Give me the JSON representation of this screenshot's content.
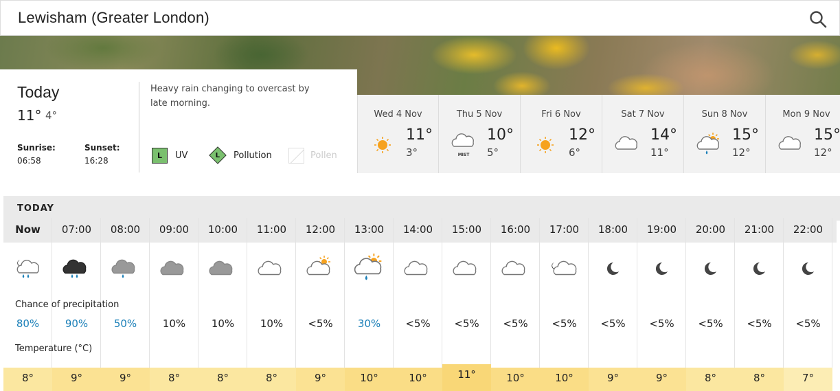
{
  "location": "Lewisham (Greater London)",
  "today": {
    "title": "Today",
    "high": "11°",
    "low": "4°",
    "sunrise_label": "Sunrise:",
    "sunrise": "06:58",
    "sunset_label": "Sunset:",
    "sunset": "16:28",
    "description": "Heavy rain changing to overcast by late morning.",
    "uv": {
      "level": "L",
      "label": "UV"
    },
    "pollution": {
      "level": "L",
      "label": "Pollution"
    },
    "pollen": {
      "label": "Pollen"
    }
  },
  "days": [
    {
      "name": "Wed 4 Nov",
      "icon": "sun",
      "high": "11°",
      "low": "3°"
    },
    {
      "name": "Thu 5 Nov",
      "icon": "mist",
      "high": "10°",
      "low": "5°"
    },
    {
      "name": "Fri 6 Nov",
      "icon": "sun",
      "high": "12°",
      "low": "6°"
    },
    {
      "name": "Sat 7 Nov",
      "icon": "cloud",
      "high": "14°",
      "low": "11°"
    },
    {
      "name": "Sun 8 Nov",
      "icon": "sun-cloud-drizzle",
      "high": "15°",
      "low": "12°"
    },
    {
      "name": "Mon 9 Nov",
      "icon": "cloud",
      "high": "15°",
      "low": "12°"
    }
  ],
  "hourly": {
    "section_label": "TODAY",
    "precip_label": "Chance of precipitation",
    "temp_label": "Temperature (°C)",
    "hours": [
      {
        "time": "Now",
        "icon": "moon-cloud-rain",
        "precip": "80%",
        "wet": true,
        "temp": "8°",
        "color": "#fbe7a0"
      },
      {
        "time": "07:00",
        "icon": "dark-cloud-rain",
        "precip": "90%",
        "wet": true,
        "temp": "9°",
        "color": "#fbe293"
      },
      {
        "time": "08:00",
        "icon": "grey-cloud-drizzle",
        "precip": "50%",
        "wet": true,
        "temp": "9°",
        "color": "#fbe293"
      },
      {
        "time": "09:00",
        "icon": "grey-cloud",
        "precip": "10%",
        "wet": false,
        "temp": "8°",
        "color": "#fbe7a0"
      },
      {
        "time": "10:00",
        "icon": "grey-cloud",
        "precip": "10%",
        "wet": false,
        "temp": "8°",
        "color": "#fbe7a0"
      },
      {
        "time": "11:00",
        "icon": "white-cloud",
        "precip": "10%",
        "wet": false,
        "temp": "8°",
        "color": "#fbe7a0"
      },
      {
        "time": "12:00",
        "icon": "sun-cloud",
        "precip": "<5%",
        "wet": false,
        "temp": "9°",
        "color": "#fbe293"
      },
      {
        "time": "13:00",
        "icon": "sun-cloud-drizzle",
        "precip": "30%",
        "wet": true,
        "temp": "10°",
        "color": "#fadd86"
      },
      {
        "time": "14:00",
        "icon": "white-cloud",
        "precip": "<5%",
        "wet": false,
        "temp": "10°",
        "color": "#fadd86"
      },
      {
        "time": "15:00",
        "icon": "white-cloud",
        "precip": "<5%",
        "wet": false,
        "temp": "11°",
        "color": "#f9d777"
      },
      {
        "time": "16:00",
        "icon": "white-cloud",
        "precip": "<5%",
        "wet": false,
        "temp": "10°",
        "color": "#fadd86"
      },
      {
        "time": "17:00",
        "icon": "moon-cloud",
        "precip": "<5%",
        "wet": false,
        "temp": "10°",
        "color": "#fadd86"
      },
      {
        "time": "18:00",
        "icon": "moon",
        "precip": "<5%",
        "wet": false,
        "temp": "9°",
        "color": "#fbe293"
      },
      {
        "time": "19:00",
        "icon": "moon",
        "precip": "<5%",
        "wet": false,
        "temp": "9°",
        "color": "#fbe293"
      },
      {
        "time": "20:00",
        "icon": "moon",
        "precip": "<5%",
        "wet": false,
        "temp": "8°",
        "color": "#fbe7a0"
      },
      {
        "time": "21:00",
        "icon": "moon",
        "precip": "<5%",
        "wet": false,
        "temp": "8°",
        "color": "#fbe7a0"
      },
      {
        "time": "22:00",
        "icon": "moon",
        "precip": "<5%",
        "wet": false,
        "temp": "7°",
        "color": "#fcedb4"
      }
    ]
  },
  "colors": {
    "rain_text": "#1a7fb8",
    "index_low": "#7ac06e",
    "sun": "#f6a21e",
    "moon": "#444444"
  }
}
